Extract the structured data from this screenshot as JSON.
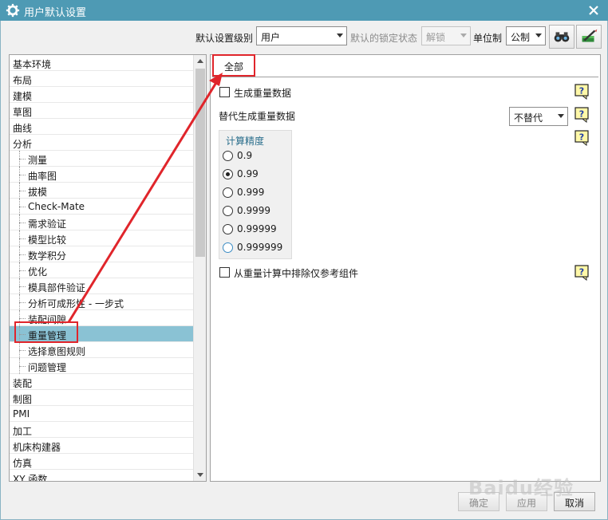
{
  "window": {
    "title": "用户默认设置"
  },
  "toolbar": {
    "level_label": "默认设置级别",
    "level_value": "用户",
    "lock_label": "默认的锁定状态",
    "lock_value": "解锁",
    "unit_label": "单位制",
    "unit_value": "公制"
  },
  "tree": {
    "items": [
      {
        "label": "基本环境",
        "level": 0
      },
      {
        "label": "布局",
        "level": 0
      },
      {
        "label": "建模",
        "level": 0
      },
      {
        "label": "草图",
        "level": 0
      },
      {
        "label": "曲线",
        "level": 0
      },
      {
        "label": "分析",
        "level": 0
      },
      {
        "label": "测量",
        "level": 1
      },
      {
        "label": "曲率图",
        "level": 1
      },
      {
        "label": "拔模",
        "level": 1
      },
      {
        "label": "Check-Mate",
        "level": 1
      },
      {
        "label": "需求验证",
        "level": 1
      },
      {
        "label": "模型比较",
        "level": 1
      },
      {
        "label": "数学积分",
        "level": 1
      },
      {
        "label": "优化",
        "level": 1
      },
      {
        "label": "模具部件验证",
        "level": 1
      },
      {
        "label": "分析可成形性 - 一步式",
        "level": 1
      },
      {
        "label": "装配间隙",
        "level": 1
      },
      {
        "label": "重量管理",
        "level": 1,
        "selected": true
      },
      {
        "label": "选择意图规则",
        "level": 1
      },
      {
        "label": "问题管理",
        "level": 1
      },
      {
        "label": "装配",
        "level": 0
      },
      {
        "label": "制图",
        "level": 0
      },
      {
        "label": "PMI",
        "level": 0
      },
      {
        "label": "加工",
        "level": 0
      },
      {
        "label": "机床构建器",
        "level": 0
      },
      {
        "label": "仿真",
        "level": 0
      },
      {
        "label": "XY 函数",
        "level": 0
      }
    ]
  },
  "panel": {
    "tab_label": "全部",
    "generate_weight_label": "生成重量数据",
    "replace_label": "替代生成重量数据",
    "replace_value": "不替代",
    "precision_group_title": "计算精度",
    "precision_options": [
      "0.9",
      "0.99",
      "0.999",
      "0.9999",
      "0.99999",
      "0.999999"
    ],
    "precision_selected": "0.99",
    "exclude_label": "从重量计算中排除仅参考组件"
  },
  "buttons": {
    "ok_label": "确定",
    "apply_label": "应用",
    "cancel_label": "取消"
  },
  "watermark": "Baidu经验",
  "colors": {
    "titlebar": "#4e9ab4",
    "selection": "#8ac2d4",
    "annotation": "#e0252b"
  }
}
